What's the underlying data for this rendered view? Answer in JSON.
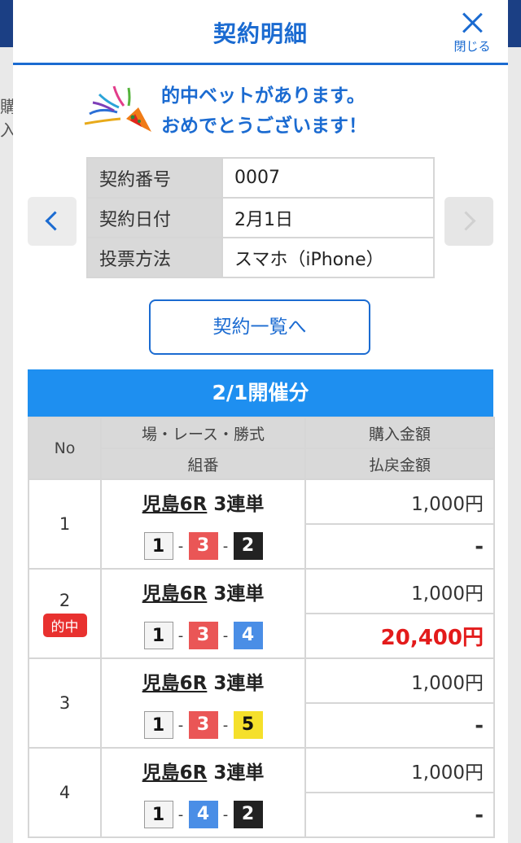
{
  "header": {
    "title": "契約明細",
    "close_label": "閉じる"
  },
  "background": {
    "text": "購入"
  },
  "congrats": {
    "line1": "的中ベットがあります。",
    "line2": "おめでとうございます！"
  },
  "contract": {
    "rows": [
      {
        "label": "契約番号",
        "value": "0007"
      },
      {
        "label": "契約日付",
        "value": "2月1日"
      },
      {
        "label": "投票方法",
        "value": "スマホ（iPhone）"
      }
    ]
  },
  "list_button": "契約一覧へ",
  "section_title": "2/1開催分",
  "table_headers": {
    "no": "No",
    "race": "場・レース・勝式",
    "combo": "組番",
    "purchase": "購入金額",
    "payout": "払戻金額"
  },
  "bets": [
    {
      "no": "1",
      "race": "児島6R",
      "type": "3連単",
      "hit": "",
      "combo": [
        "1",
        "3",
        "2"
      ],
      "purchase": "1,000円",
      "payout": "-"
    },
    {
      "no": "2",
      "race": "児島6R",
      "type": "3連単",
      "hit": "的中",
      "combo": [
        "1",
        "3",
        "4"
      ],
      "purchase": "1,000円",
      "payout": "20,400円"
    },
    {
      "no": "3",
      "race": "児島6R",
      "type": "3連単",
      "hit": "",
      "combo": [
        "1",
        "3",
        "5"
      ],
      "purchase": "1,000円",
      "payout": "-"
    },
    {
      "no": "4",
      "race": "児島6R",
      "type": "3連単",
      "hit": "",
      "combo": [
        "1",
        "4",
        "2"
      ],
      "purchase": "1,000円",
      "payout": "-"
    }
  ],
  "colors": {
    "accent": "#1b6bd1",
    "section": "#1e8ff0",
    "hit": "#e8312f",
    "boat_1": "#f4f4f4",
    "boat_2": "#222222",
    "boat_3": "#ea5656",
    "boat_4": "#4a8ee6",
    "boat_5": "#f5e02b"
  }
}
